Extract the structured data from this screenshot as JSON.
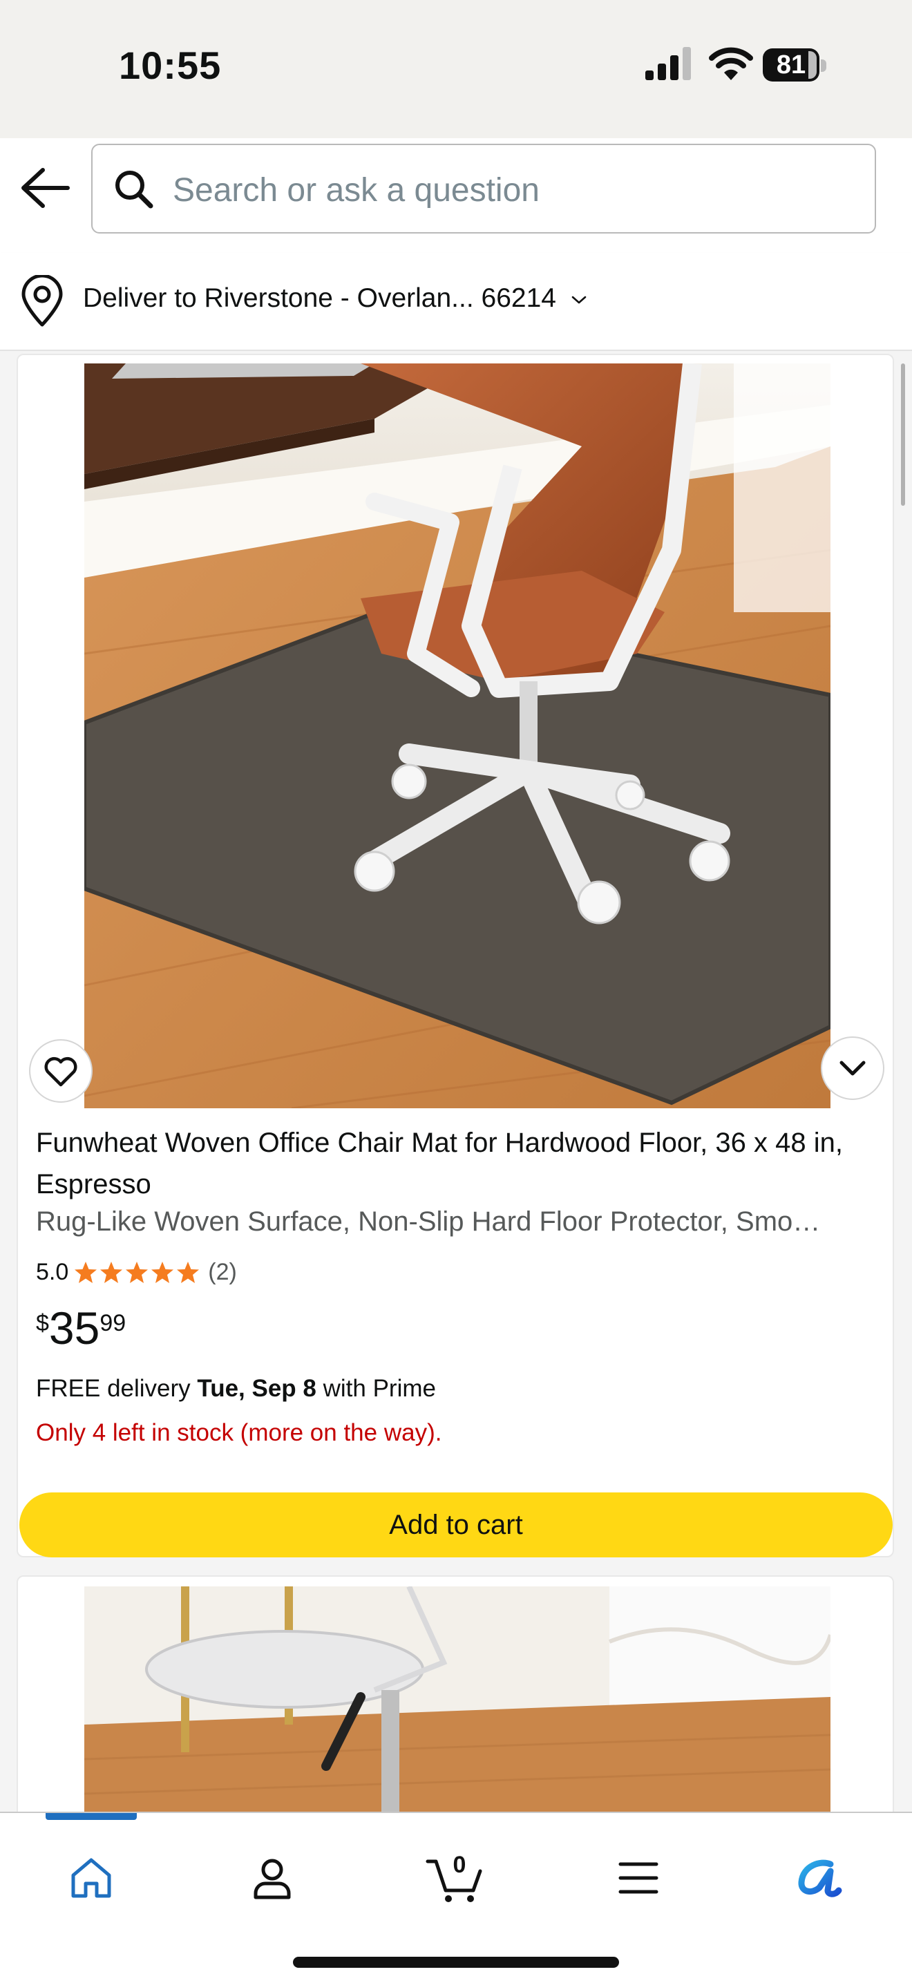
{
  "status_bar": {
    "time": "10:55",
    "battery": "81"
  },
  "search": {
    "placeholder": "Search or ask a question"
  },
  "delivery_bar": {
    "text": "Deliver to Riverstone - Overlan... 66214"
  },
  "product": {
    "title": "Funwheat Woven Office Chair Mat for Hardwood Floor, 36 x 48 in, Espresso",
    "subtitle": "Rug-Like Woven Surface, Non-Slip Hard Floor Protector, Smo…",
    "rating_value": "5.0",
    "rating_stars": 5,
    "rating_count": "(2)",
    "price_symbol": "$",
    "price_whole": "35",
    "price_fraction": "99",
    "delivery_prefix": "FREE delivery ",
    "delivery_date": "Tue, Sep 8",
    "delivery_suffix": " with Prime",
    "stock": "Only 4 left in stock (more on the way).",
    "add_to_cart": "Add to cart"
  },
  "tab_bar": {
    "cart_count": "0",
    "active_tab": "home"
  },
  "colors": {
    "star": "#f57c1f",
    "cart_button": "#ffd814",
    "stock_red": "#c40000",
    "active_tab": "#1f6fbf"
  }
}
